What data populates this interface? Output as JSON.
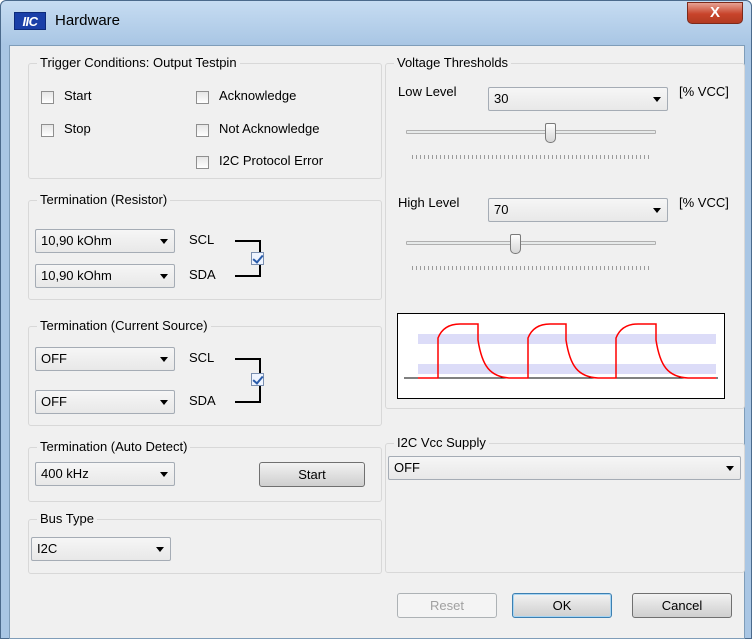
{
  "window": {
    "icon_text": "IIC",
    "title": "Hardware",
    "close_glyph": "X"
  },
  "trigger": {
    "label": "Trigger Conditions: Output Testpin",
    "start": {
      "label": "Start",
      "checked": false
    },
    "stop": {
      "label": "Stop",
      "checked": false
    },
    "ack": {
      "label": "Acknowledge",
      "checked": false
    },
    "nack": {
      "label": "Not Acknowledge",
      "checked": false
    },
    "proto": {
      "label": "I2C Protocol Error",
      "checked": false
    }
  },
  "term_resistor": {
    "label": "Termination (Resistor)",
    "scl_value": "10,90 kOhm",
    "sda_value": "10,90 kOhm",
    "scl_label": "SCL",
    "sda_label": "SDA",
    "linked": true
  },
  "term_current": {
    "label": "Termination (Current Source)",
    "scl_value": "OFF",
    "sda_value": "OFF",
    "scl_label": "SCL",
    "sda_label": "SDA",
    "linked": true
  },
  "auto_detect": {
    "label": "Termination (Auto Detect)",
    "value": "400 kHz",
    "start_label": "Start"
  },
  "bus_type": {
    "label": "Bus Type",
    "value": "I2C"
  },
  "voltage": {
    "label": "Voltage Thresholds",
    "low_label": "Low Level",
    "low_value": "30",
    "high_label": "High Level",
    "high_value": "70",
    "unit": "[% VCC]",
    "low_slider_fraction": 0.58,
    "high_slider_fraction": 0.44,
    "signal_color": "#ff0000",
    "band_color": "#dcdcf8"
  },
  "vcc": {
    "label": "I2C Vcc Supply",
    "value": "OFF"
  },
  "buttons": {
    "reset": "Reset",
    "ok": "OK",
    "cancel": "Cancel"
  },
  "accent": {
    "close": "#c8442b",
    "default_button": "#3c7fb1"
  }
}
